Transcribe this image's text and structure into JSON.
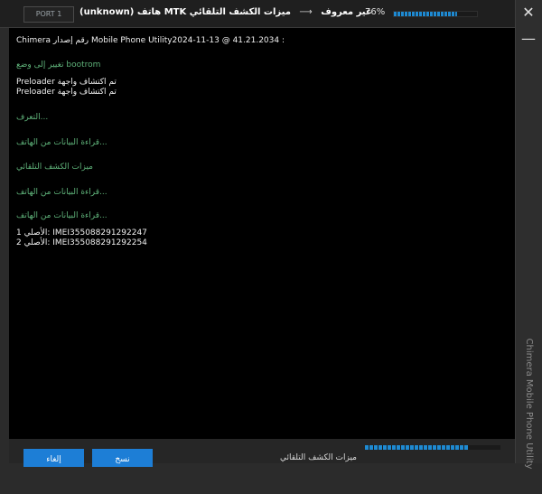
{
  "header": {
    "port_label": "PORT 1",
    "title_left": "(unknown) هاتف MTK غير معروف",
    "arrow": "⟶",
    "title_right": "ميزات الكشف التلقائي",
    "progress_label": "76%",
    "progress_value": 0.76
  },
  "window": {
    "close_glyph": "✕",
    "minimize_glyph": "—",
    "vertical_label": "Chimera Mobile Phone Utility"
  },
  "log": {
    "lines": [
      {
        "text": "Chimera رقم إصدار Mobile Phone Utility2024-11-13 @ 41.21.2034 :",
        "color": "white"
      },
      {
        "text": "تغيير إلى وضع bootrom",
        "color": "green"
      },
      {
        "text": "Preloader تم اكتشاف واجهة",
        "color": "white"
      },
      {
        "text": "Preloader تم اكتشاف واجهة",
        "color": "white"
      },
      {
        "text": "التعرف...",
        "color": "green"
      },
      {
        "text": "قراءة البيانات من الهاتف...",
        "color": "green"
      },
      {
        "text": "ميزات الكشف التلقائي",
        "color": "green"
      },
      {
        "text": "قراءة البيانات من الهاتف...",
        "color": "green"
      },
      {
        "text": "قراءة البيانات من الهاتف...",
        "color": "green"
      },
      {
        "text": "الأصلي 1: IMEI355088291292247",
        "color": "white"
      },
      {
        "text": "الأصلي 2: IMEI355088291292254",
        "color": "white"
      }
    ]
  },
  "footer": {
    "cancel_label": "إلغاء",
    "copy_label": "نسخ",
    "status_text": "ميزات الكشف التلقائي",
    "progress_value": 0.76
  }
}
